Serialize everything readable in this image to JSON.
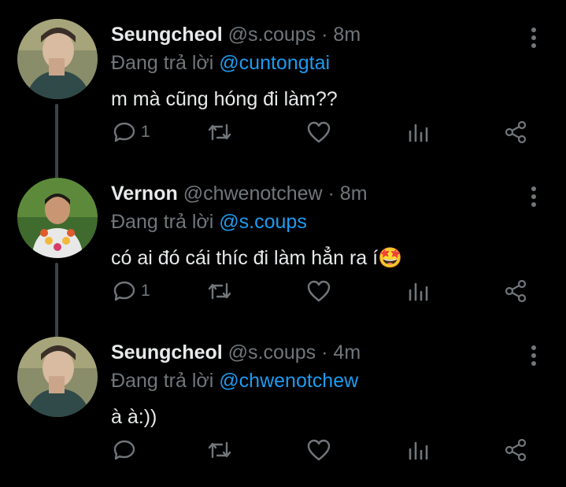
{
  "tweets": [
    {
      "name": "Seungcheol",
      "handle": "@s.coups",
      "dot": "·",
      "time": "8m",
      "reply_prefix": "Đang trả lời",
      "reply_to": "@cuntongtai",
      "text": "m mà cũng hóng đi làm??",
      "reply_count": "1",
      "avatar": "avatar-seungcheol"
    },
    {
      "name": "Vernon",
      "handle": "@chwenotchew",
      "dot": "·",
      "time": "8m",
      "reply_prefix": "Đang trả lời",
      "reply_to": "@s.coups",
      "text": "có ai đó cái thíc đi làm hẳn ra í",
      "emoji": "🤩",
      "reply_count": "1",
      "avatar": "avatar-vernon"
    },
    {
      "name": "Seungcheol",
      "handle": "@s.coups",
      "dot": "·",
      "time": "4m",
      "reply_prefix": "Đang trả lời",
      "reply_to": "@chwenotchew",
      "text": "à à:))",
      "reply_count": "",
      "avatar": "avatar-seungcheol"
    }
  ],
  "icons": {
    "more": "more-vertical-icon",
    "reply": "reply-icon",
    "retweet": "retweet-icon",
    "like": "heart-icon",
    "analytics": "analytics-icon",
    "share": "share-icon"
  },
  "colors": {
    "background": "#000000",
    "text": "#e7e9ea",
    "muted": "#71767b",
    "accent": "#1d9bf0",
    "thread_line": "#3d4247"
  }
}
